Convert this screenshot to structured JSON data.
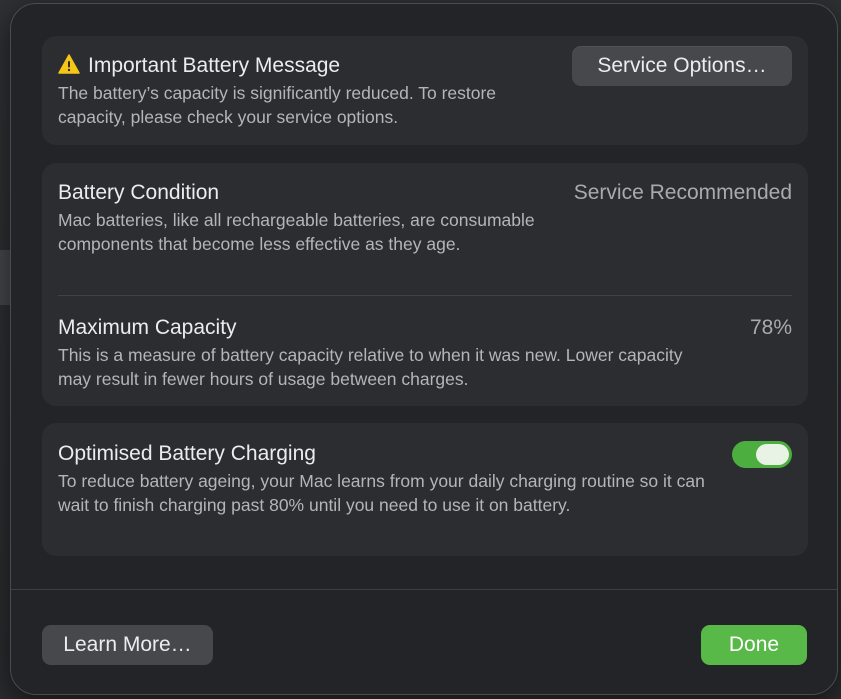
{
  "colors": {
    "accent_green": "#59b948",
    "warning_yellow": "#f5c518"
  },
  "battery_message": {
    "icon": "warning-icon",
    "title": "Important Battery Message",
    "description": "The battery’s capacity is significantly reduced. To restore capacity, please check your service options.",
    "service_button_label": "Service Options…"
  },
  "battery_condition": {
    "title": "Battery Condition",
    "value": "Service Recommended",
    "description": "Mac batteries, like all rechargeable batteries, are consumable components that become less effective as they age."
  },
  "maximum_capacity": {
    "title": "Maximum Capacity",
    "value": "78%",
    "description": "This is a measure of battery capacity relative to when it was new. Lower capacity may result in fewer hours of usage between charges."
  },
  "optimised_charging": {
    "title": "Optimised Battery Charging",
    "enabled": true,
    "description": "To reduce battery ageing, your Mac learns from your daily charging routine so it can wait to finish charging past 80% until you need to use it on battery."
  },
  "footer": {
    "learn_more_label": "Learn More…",
    "done_label": "Done"
  }
}
